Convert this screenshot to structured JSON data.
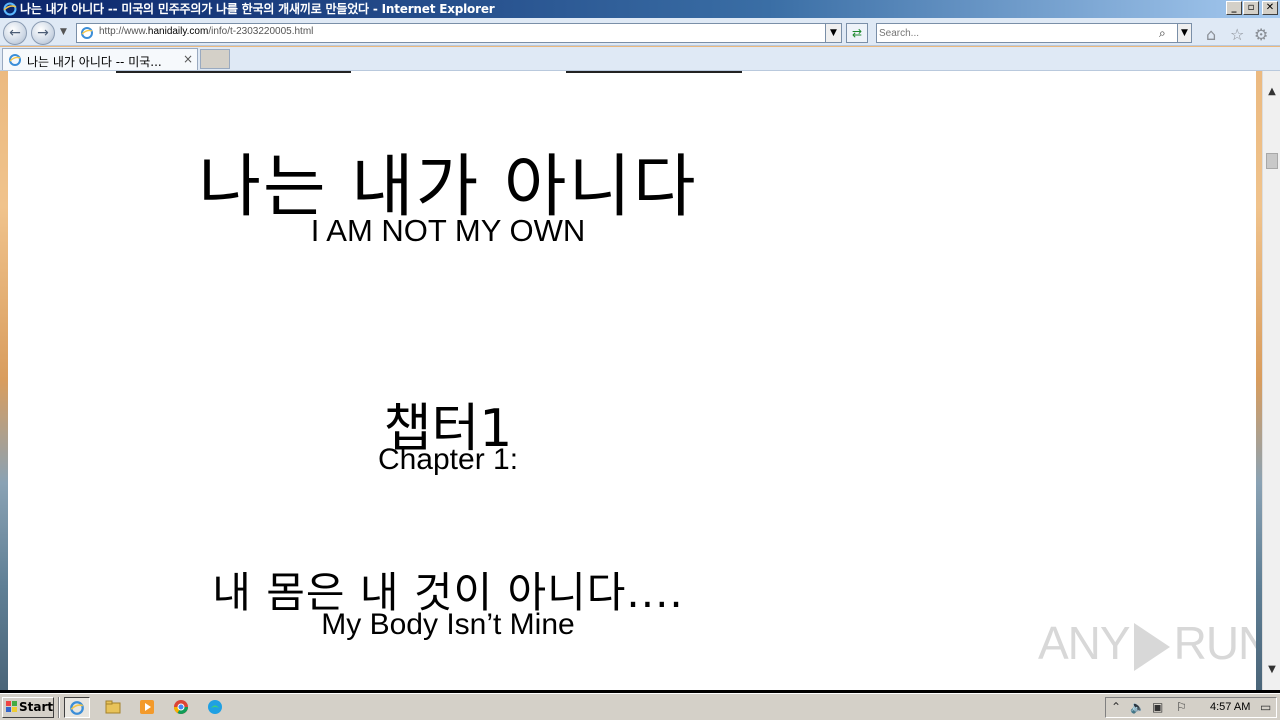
{
  "window": {
    "title": "나는 내가 아니다 -- 미국의 민주주의가 나를 한국의 개새끼로 만들었다 - Internet Explorer",
    "minimize_label": "_",
    "restore_label": "▫",
    "close_label": "✕"
  },
  "navbar": {
    "back_label": "←",
    "forward_label": "→",
    "url_prefix": "http://www.",
    "url_domain": "hanidaily.com",
    "url_path": "/info/t-2303220005.html",
    "refresh_label": "⇄",
    "search_placeholder": "Search..."
  },
  "tabs": [
    {
      "title": "나는 내가 아니다 -- 미국...",
      "close_label": "×"
    }
  ],
  "page": {
    "heading_ko": "나는 내가 아니다",
    "heading_en": "I AM NOT MY OWN",
    "chapter_ko": "챕터1",
    "chapter_en": "Chapter 1:",
    "subtitle_ko": "내 몸은 내 것이 아니다....",
    "subtitle_en": "My Body Isn’t Mine"
  },
  "watermark": {
    "left": "ANY",
    "right": "RUN"
  },
  "taskbar": {
    "start_label": "Start",
    "apps": [
      "internet-explorer",
      "file-explorer",
      "media-player",
      "chrome",
      "edge"
    ],
    "clock": "4:57 AM"
  },
  "colors": {
    "titlebar_start": "#0a246a",
    "titlebar_end": "#a6caf0",
    "taskbar": "#d4d0c8",
    "page_bg": "#ffffff"
  }
}
